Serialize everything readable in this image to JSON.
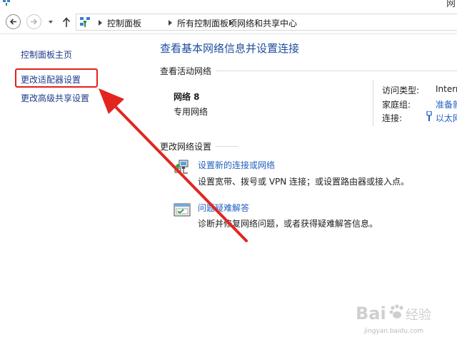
{
  "window": {
    "title_fragment": "网"
  },
  "breadcrumb": {
    "items": [
      "控制面板",
      "所有控制面板项",
      "网络和共享中心"
    ]
  },
  "sidebar": {
    "links": [
      {
        "label": "控制面板主页"
      },
      {
        "label": "更改适配器设置"
      },
      {
        "label": "更改高级共享设置"
      }
    ]
  },
  "main": {
    "title": "查看基本网络信息并设置连接",
    "active_networks": {
      "header": "查看活动网络",
      "network_name": "网络  8",
      "network_type": "专用网络",
      "properties": [
        {
          "label": "访问类型:",
          "value": "Intern"
        },
        {
          "label": "家庭组:",
          "value": "准备就"
        },
        {
          "label": "连接:",
          "value": "以太网"
        }
      ]
    },
    "change_settings": {
      "header": "更改网络设置",
      "tasks": [
        {
          "link": "设置新的连接或网络",
          "desc": "设置宽带、拨号或 VPN 连接；或设置路由器或接入点。"
        },
        {
          "link": "问题疑难解答",
          "desc": "诊断并修复网络问题，或者获得疑难解答信息。"
        }
      ]
    }
  },
  "watermark": {
    "brand": "Bai",
    "brand_suffix": "经验",
    "url": "jingyan.baidu.com"
  },
  "colors": {
    "link": "#1f5fbf",
    "title": "#1e4e9e",
    "highlight": "#e2201c"
  }
}
